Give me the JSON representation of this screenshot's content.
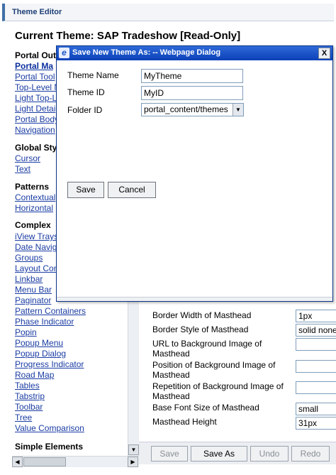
{
  "header": {
    "title": "Theme Editor"
  },
  "current_theme": {
    "title": "Current Theme: SAP Tradeshow [Read-Only]"
  },
  "sidebar": {
    "sections": [
      {
        "heading": "Portal Out",
        "items": [
          "Portal Ma",
          "Portal Tool",
          "Top-Level N",
          "Light Top-L",
          "Light Detai",
          "Portal Body",
          "Navigation"
        ]
      },
      {
        "heading": "Global Sty",
        "items": [
          "Cursor",
          "Text"
        ]
      },
      {
        "heading": "Patterns",
        "items": [
          "Contextual",
          "Horizontal"
        ]
      },
      {
        "heading": "Complex",
        "items": [
          "iView Trays",
          "Date Navig",
          "Groups",
          "Layout Con",
          "Linkbar",
          "Menu Bar",
          "Paginator",
          "Pattern Containers",
          "Phase Indicator",
          "Popin",
          "Popup Menu",
          "Popup Dialog",
          "Progress Indicator",
          "Road Map",
          "Tables",
          "Tabstrip",
          "Toolbar",
          "Tree",
          "Value Comparison"
        ]
      },
      {
        "heading": "Simple Elements",
        "items": []
      }
    ]
  },
  "properties": {
    "rows": [
      {
        "label": "Border Width of Masthead",
        "value": "1px"
      },
      {
        "label": "Border Style of Masthead",
        "value": "solid none"
      },
      {
        "label": "URL to Background Image of Masthead",
        "value": ""
      },
      {
        "label": "Position of Background Image of Masthead",
        "value": ""
      },
      {
        "label": "Repetition of Background Image of Masthead",
        "value": ""
      },
      {
        "label": "Base Font Size of Masthead",
        "value": "small"
      },
      {
        "label": "Masthead Height",
        "value": "31px"
      }
    ]
  },
  "bottom_bar": {
    "save": "Save",
    "save_as": "Save As",
    "undo": "Undo",
    "redo": "Redo"
  },
  "dialog": {
    "title": "Save New Theme As: -- Webpage Dialog",
    "close": "X",
    "theme_name_label": "Theme Name",
    "theme_name_value": "MyTheme",
    "theme_id_label": "Theme ID",
    "theme_id_value": "MyID",
    "folder_id_label": "Folder ID",
    "folder_id_value": "portal_content/themes",
    "save": "Save",
    "cancel": "Cancel"
  },
  "colors": {
    "accent": "#3f6fa6",
    "dialog_title": "#0b40b8",
    "link": "#1a3ca3"
  },
  "icons": [
    "ie-icon",
    "close-icon",
    "scroll-up-icon",
    "scroll-down-icon",
    "scroll-left-icon",
    "scroll-right-icon",
    "dropdown-arrow-icon"
  ]
}
